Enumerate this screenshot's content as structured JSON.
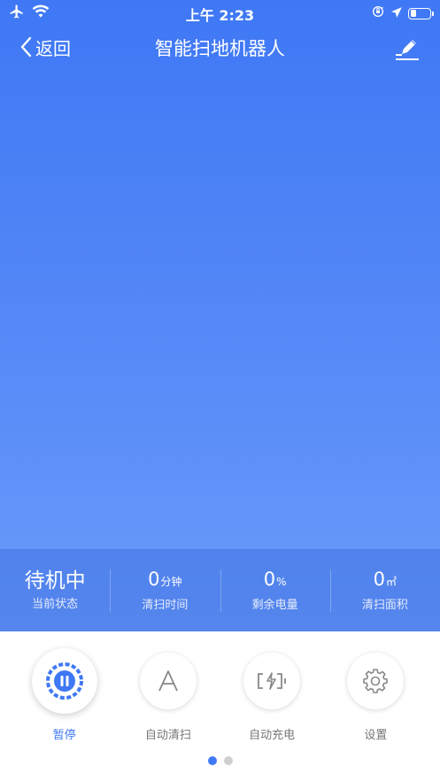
{
  "status_bar": {
    "time": "上午 2:23"
  },
  "nav": {
    "back_label": "返回",
    "title": "智能扫地机器人"
  },
  "stats": [
    {
      "value": "待机中",
      "unit": "",
      "label": "当前状态"
    },
    {
      "value": "0",
      "unit": "分钟",
      "label": "清扫时间"
    },
    {
      "value": "0",
      "unit": "%",
      "label": "剩余电量"
    },
    {
      "value": "0",
      "unit": "㎡",
      "label": "清扫面积"
    }
  ],
  "controls": [
    {
      "label": "暂停",
      "icon": "pause-icon",
      "active": true
    },
    {
      "label": "自动清扫",
      "icon": "auto-letter-icon",
      "active": false
    },
    {
      "label": "自动充电",
      "icon": "battery-charge-icon",
      "active": false
    },
    {
      "label": "设置",
      "icon": "gear-icon",
      "active": false
    }
  ],
  "pagination": {
    "pages": 2,
    "current_page": 1
  },
  "colors": {
    "accent": "#3f78f5",
    "gradient_top": "#3f78f5",
    "gradient_bottom": "#6a9bfa",
    "inactive_label": "#777777"
  }
}
